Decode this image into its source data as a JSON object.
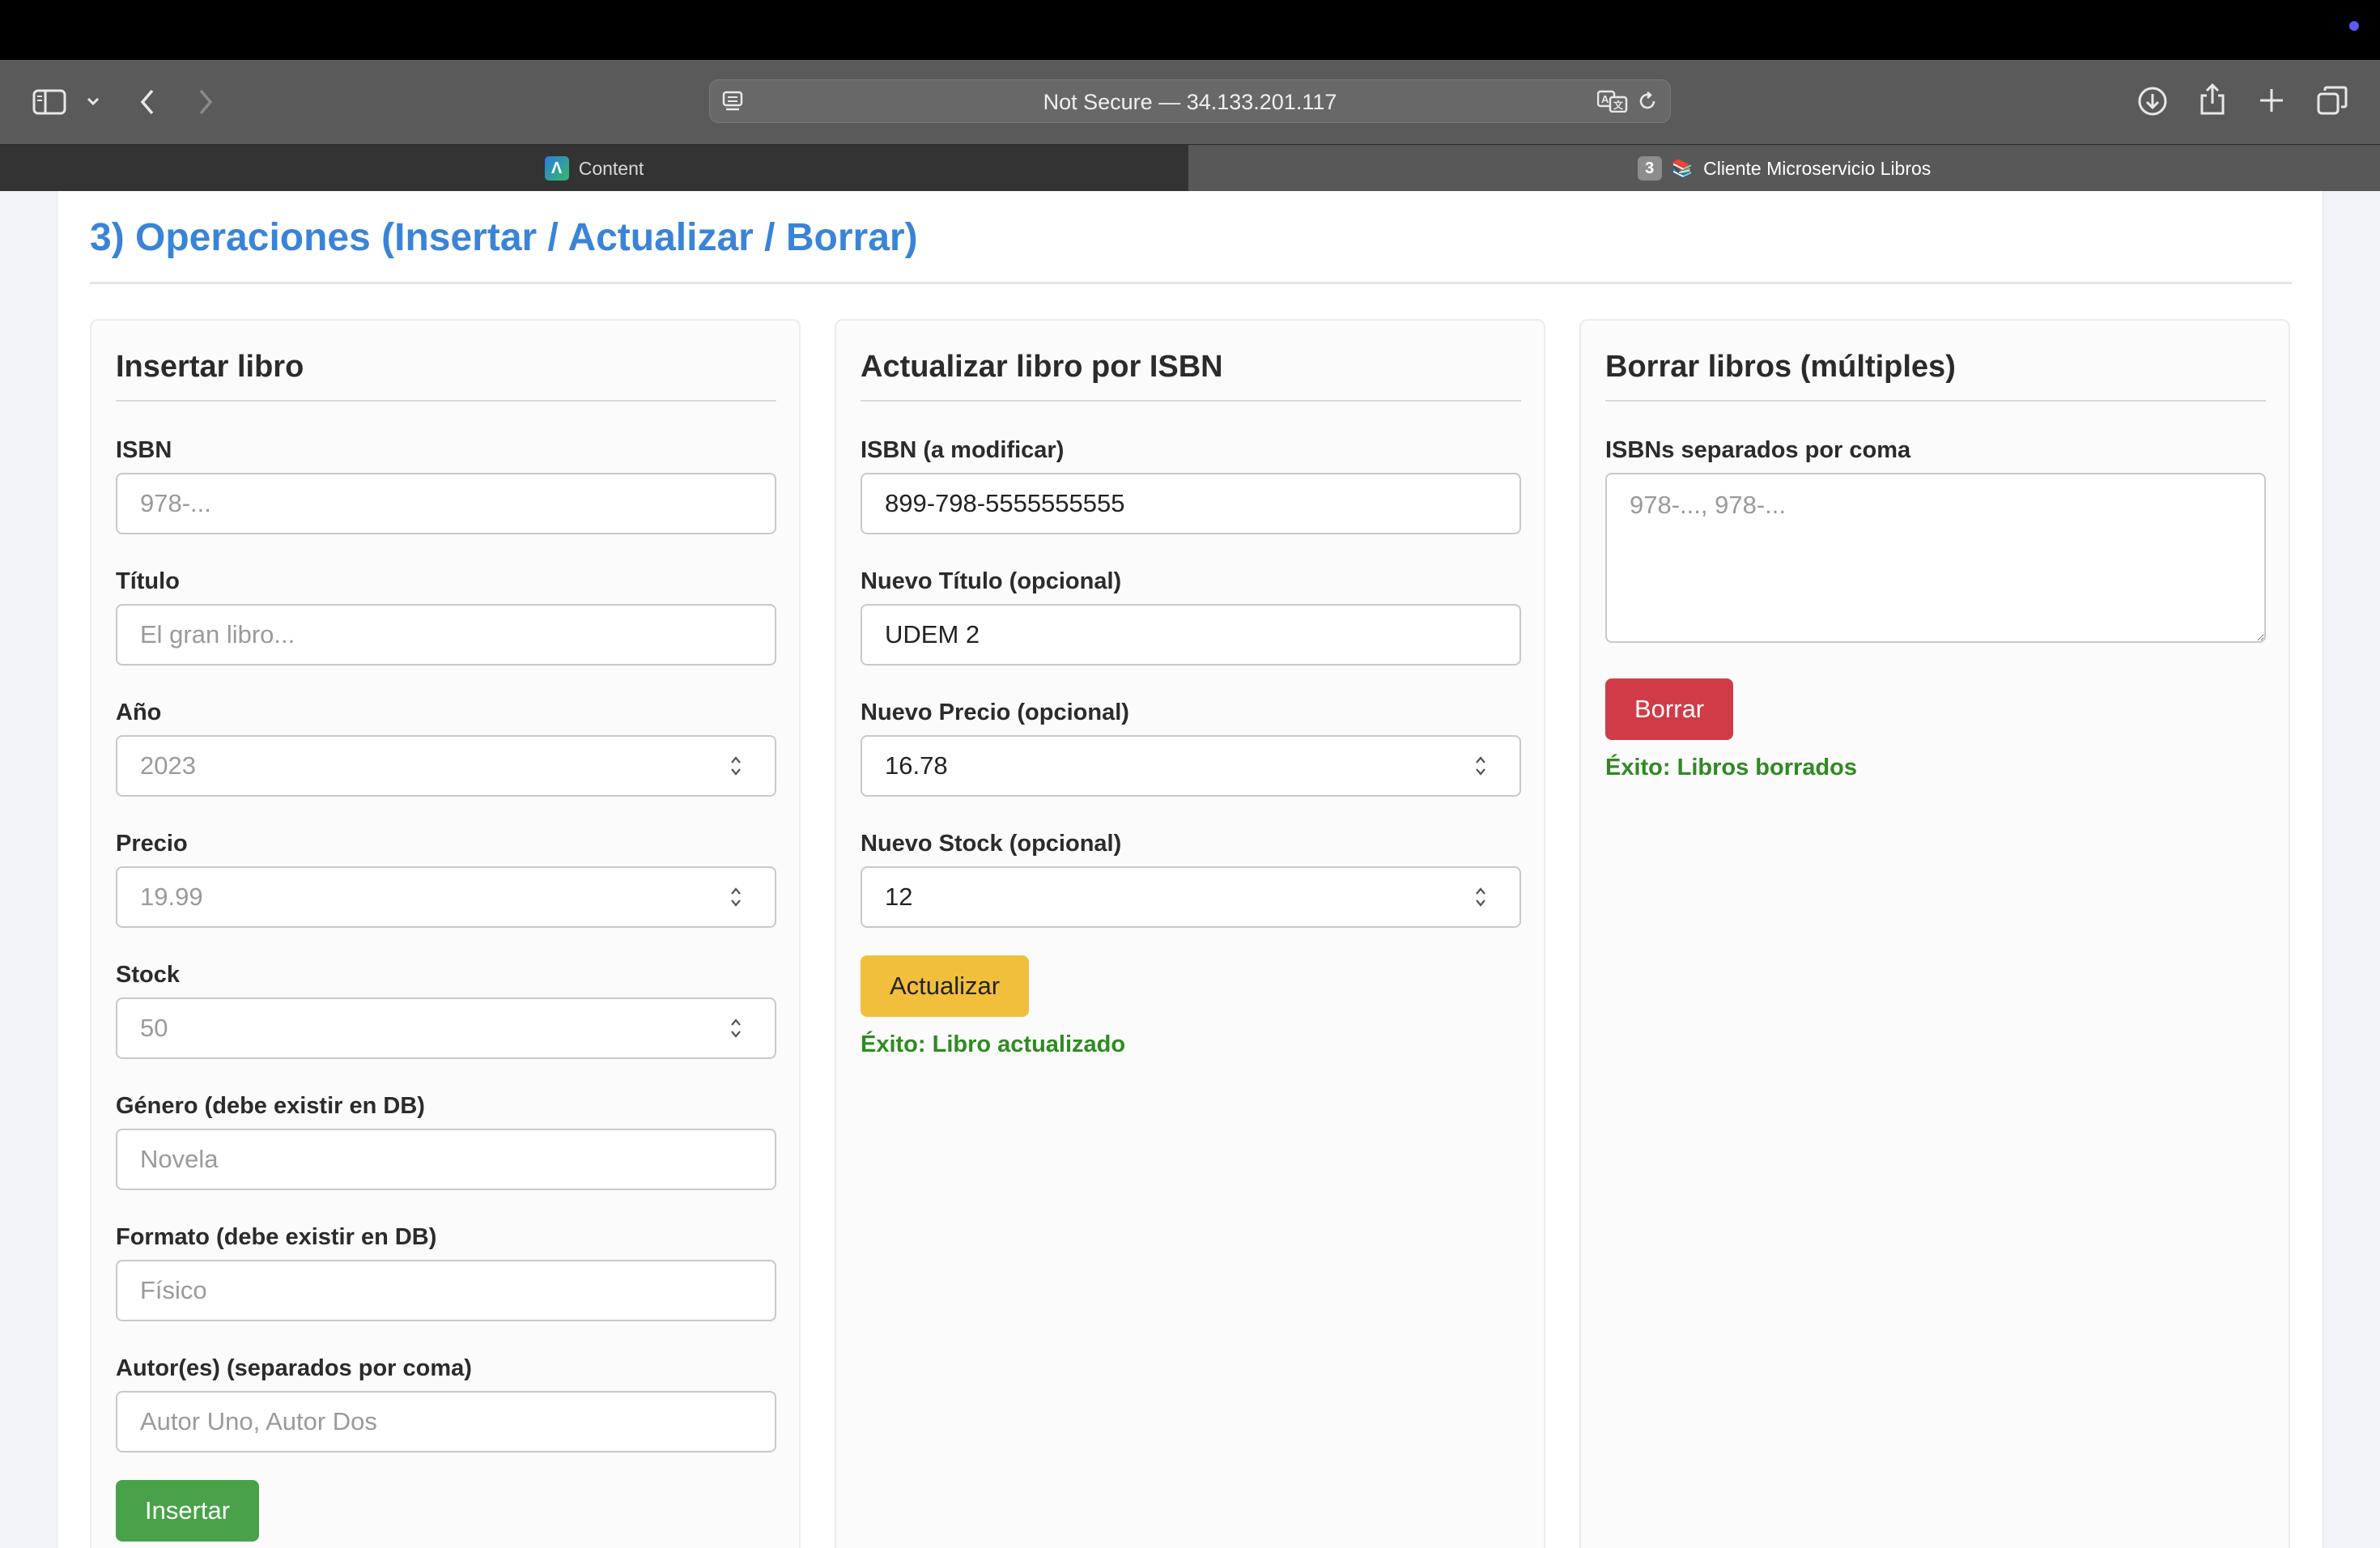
{
  "browser": {
    "address_text": "Not Secure — 34.133.201.117",
    "tabs": [
      {
        "label": "Content",
        "icon": "app-logo-icon",
        "active": false
      },
      {
        "label": "Cliente Microservicio Libros",
        "icon": "books-icon",
        "count": "3",
        "active": true
      }
    ]
  },
  "page": {
    "section_title": "3) Operaciones (Insertar / Actualizar / Borrar)"
  },
  "insert": {
    "title": "Insertar libro",
    "isbn_label": "ISBN",
    "isbn_placeholder": "978-...",
    "titulo_label": "Título",
    "titulo_placeholder": "El gran libro...",
    "anio_label": "Año",
    "anio_placeholder": "2023",
    "precio_label": "Precio",
    "precio_placeholder": "19.99",
    "stock_label": "Stock",
    "stock_placeholder": "50",
    "genero_label": "Género (debe existir en DB)",
    "genero_placeholder": "Novela",
    "formato_label": "Formato (debe existir en DB)",
    "formato_placeholder": "Físico",
    "autores_label": "Autor(es) (separados por coma)",
    "autores_placeholder": "Autor Uno, Autor Dos",
    "button": "Insertar"
  },
  "update": {
    "title": "Actualizar libro por ISBN",
    "isbn_label": "ISBN (a modificar)",
    "isbn_value": "899-798-5555555555",
    "titulo_label": "Nuevo Título (opcional)",
    "titulo_value": "UDEM 2",
    "precio_label": "Nuevo Precio (opcional)",
    "precio_value": "16.78",
    "stock_label": "Nuevo Stock (opcional)",
    "stock_value": "12",
    "button": "Actualizar",
    "message": "Éxito: Libro actualizado"
  },
  "delete": {
    "title": "Borrar libros (múltiples)",
    "isbns_label": "ISBNs separados por coma",
    "isbns_placeholder": "978-..., 978-...",
    "button": "Borrar",
    "message": "Éxito: Libros borrados"
  },
  "colors": {
    "accent": "#3a84d8",
    "insert_button": "#49a249",
    "update_button": "#f2bf3c",
    "delete_button": "#d13b47",
    "success_text": "#2f8a22"
  }
}
